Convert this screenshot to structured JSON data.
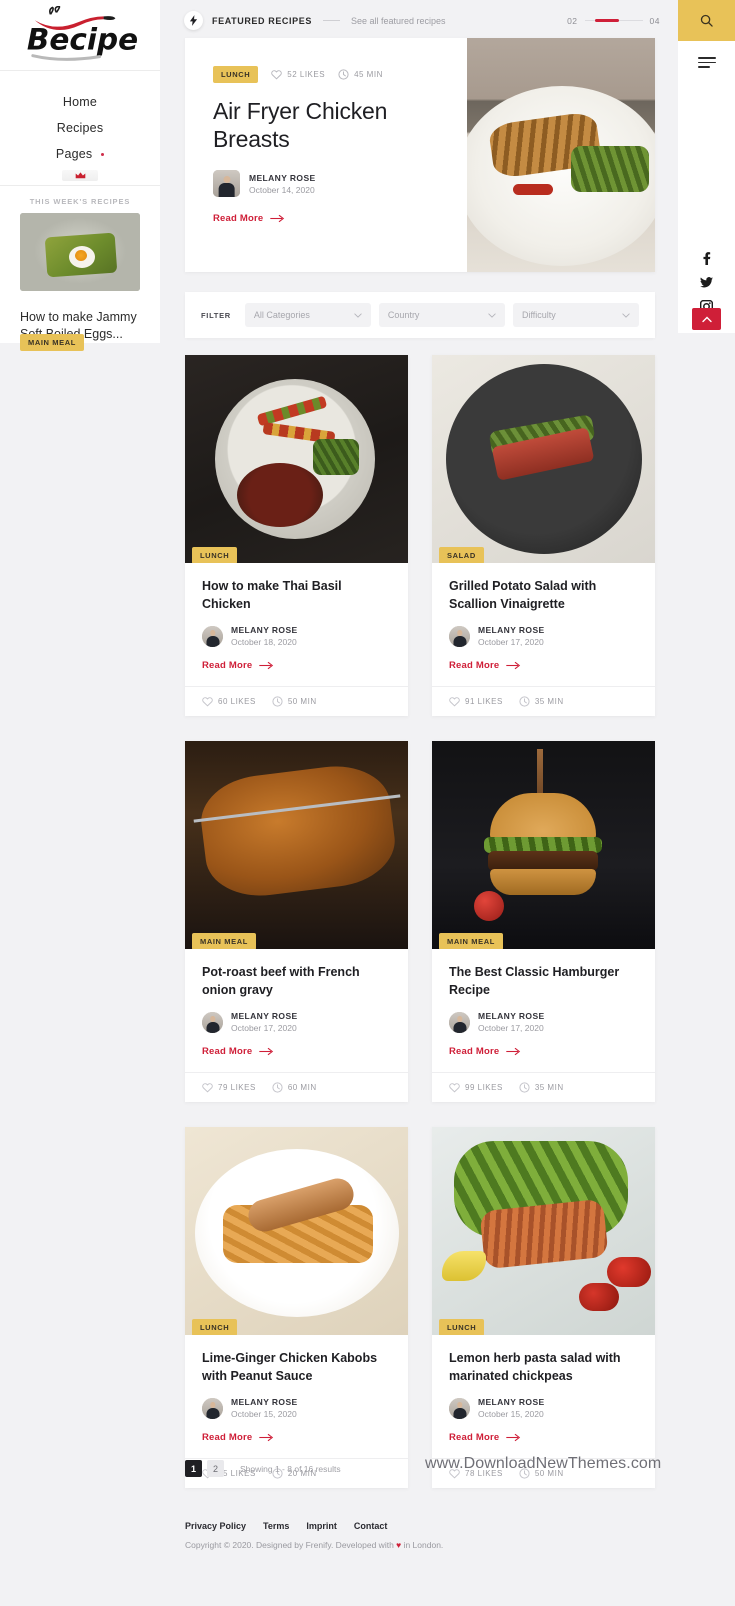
{
  "brand": {
    "logo_text": "Recipe"
  },
  "sidebar": {
    "nav": [
      {
        "label": "Home",
        "has_dot": false
      },
      {
        "label": "Recipes",
        "has_dot": false
      },
      {
        "label": "Pages",
        "has_dot": true
      }
    ],
    "crown_icon": "crown-icon",
    "week_section_label": "THIS WEEK'S RECIPES",
    "week_card": {
      "badge": "MAIN MEAL",
      "title": "How to make Jammy Soft Boiled Eggs..."
    }
  },
  "topbar": {
    "bolt_icon": "bolt-icon",
    "title": "FEATURED RECIPES",
    "see_all": "See all featured recipes",
    "current_index": "02",
    "total_index": "04"
  },
  "rail": {
    "search_icon": "search-icon",
    "menu_icon": "hamburger-menu-icon",
    "socials": [
      "facebook-icon",
      "twitter-icon",
      "instagram-icon"
    ],
    "to_top_icon": "chevron-up-icon"
  },
  "hero": {
    "badge": "LUNCH",
    "likes": "52 LIKES",
    "time": "45 MIN",
    "title": "Air Fryer Chicken Breasts",
    "author": "MELANY ROSE",
    "date": "October 14, 2020",
    "read_more": "Read More"
  },
  "filter": {
    "label": "FILTER",
    "selects": [
      {
        "value": "All Categories",
        "name": "category"
      },
      {
        "value": "Country",
        "name": "country"
      },
      {
        "value": "Difficulty",
        "name": "difficulty"
      }
    ]
  },
  "cards": [
    {
      "badge": "LUNCH",
      "title": "How to make Thai Basil Chicken",
      "author": "MELANY ROSE",
      "date": "October 18, 2020",
      "read_more": "Read More",
      "likes": "60 LIKES",
      "time": "50 MIN",
      "art": "art1"
    },
    {
      "badge": "SALAD",
      "title": "Grilled Potato Salad with Scallion Vinaigrette",
      "author": "MELANY ROSE",
      "date": "October 17, 2020",
      "read_more": "Read More",
      "likes": "91 LIKES",
      "time": "35 MIN",
      "art": "art2"
    },
    {
      "badge": "MAIN MEAL",
      "title": "Pot-roast beef with French onion gravy",
      "author": "MELANY ROSE",
      "date": "October 17, 2020",
      "read_more": "Read More",
      "likes": "79 LIKES",
      "time": "60 MIN",
      "art": "art3"
    },
    {
      "badge": "MAIN MEAL",
      "title": "The Best Classic Hamburger Recipe",
      "author": "MELANY ROSE",
      "date": "October 17, 2020",
      "read_more": "Read More",
      "likes": "99 LIKES",
      "time": "35 MIN",
      "art": "art4"
    },
    {
      "badge": "LUNCH",
      "title": "Lime-Ginger Chicken Kabobs with Peanut Sauce",
      "author": "MELANY ROSE",
      "date": "October 15, 2020",
      "read_more": "Read More",
      "likes": "95 LIKES",
      "time": "20 MIN",
      "art": "art5"
    },
    {
      "badge": "LUNCH",
      "title": "Lemon herb pasta salad with marinated chickpeas",
      "author": "MELANY ROSE",
      "date": "October 15, 2020",
      "read_more": "Read More",
      "likes": "78 LIKES",
      "time": "50 MIN",
      "art": "art6"
    }
  ],
  "pagination": {
    "pages": [
      "1",
      "2"
    ],
    "active": "1",
    "showing": "Showing 1 - 8 of 16 results"
  },
  "watermark": "www.DownloadNewThemes.com",
  "footer": {
    "links": [
      "Privacy Policy",
      "Terms",
      "Imprint",
      "Contact"
    ],
    "copyright_before": "Copyright © 2020. Designed by Frenify. Developed with ",
    "copyright_heart": "♥",
    "copyright_after": " in London."
  },
  "colors": {
    "accent_red": "#cf1f38",
    "badge_yellow": "#e8c258",
    "dark": "#1f1f23",
    "muted": "#9b9ba1"
  }
}
